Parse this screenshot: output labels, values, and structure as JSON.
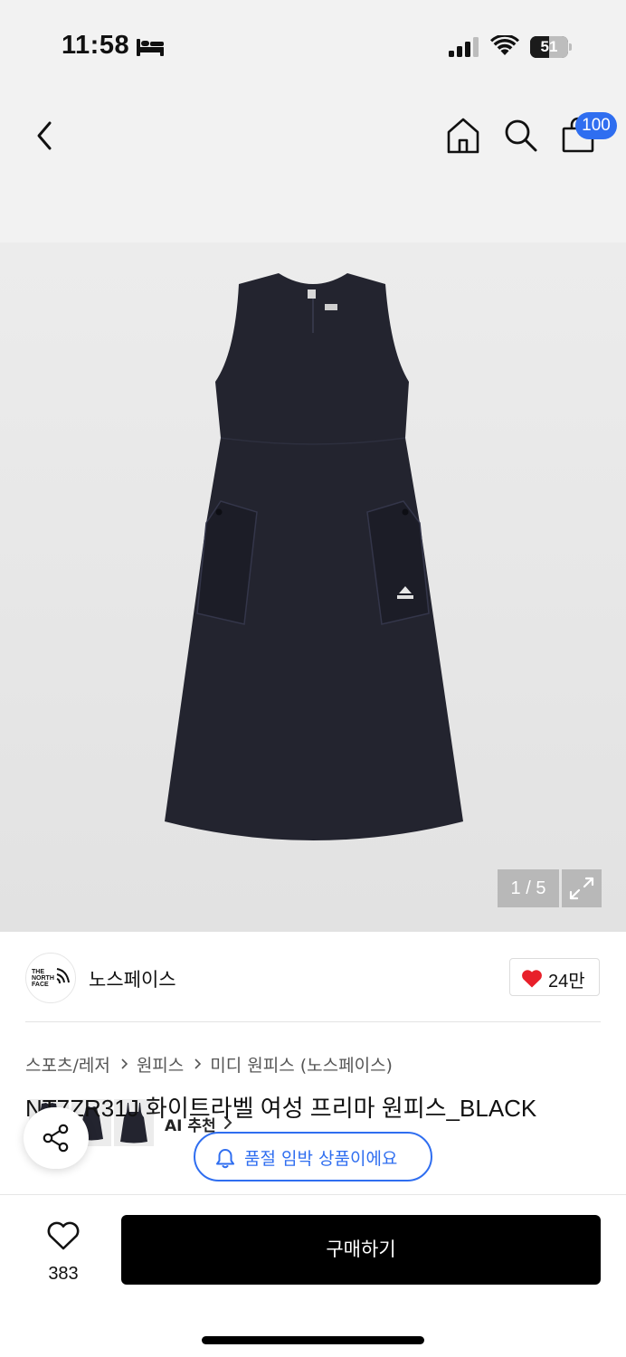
{
  "status_bar": {
    "time": "11:58",
    "battery_percent": "51",
    "battery_level": 0.51
  },
  "header": {
    "icons": [
      "back-arrow-icon",
      "home-icon",
      "search-icon",
      "shopping-bag-icon"
    ],
    "cart_badge": "100"
  },
  "gallery": {
    "thumbnails": [
      "dress-thumbnail-1",
      "dress-thumbnail-2",
      "dress-thumbnail-3"
    ],
    "ai_recommend_label": "AI 추천",
    "page_indicator": "1 / 5",
    "expand_icon": "expand-icon"
  },
  "brand": {
    "name": "노스페이스",
    "logo_text": "THE NORTH FACE",
    "like_count": "24만",
    "like_color": "#e8202a"
  },
  "breadcrumb": [
    "스포츠/레저",
    "원피스",
    "미디 원피스 (노스페이스)"
  ],
  "product": {
    "title": "NT7ZR31J 화이트라벨 여성 프리마 원피스_BLACK"
  },
  "notice": {
    "stock_text": "품절 임박 상품이에요",
    "accent": "#2f6ef0"
  },
  "bottom_bar": {
    "wish_count": "383",
    "buy_label": "구매하기"
  }
}
